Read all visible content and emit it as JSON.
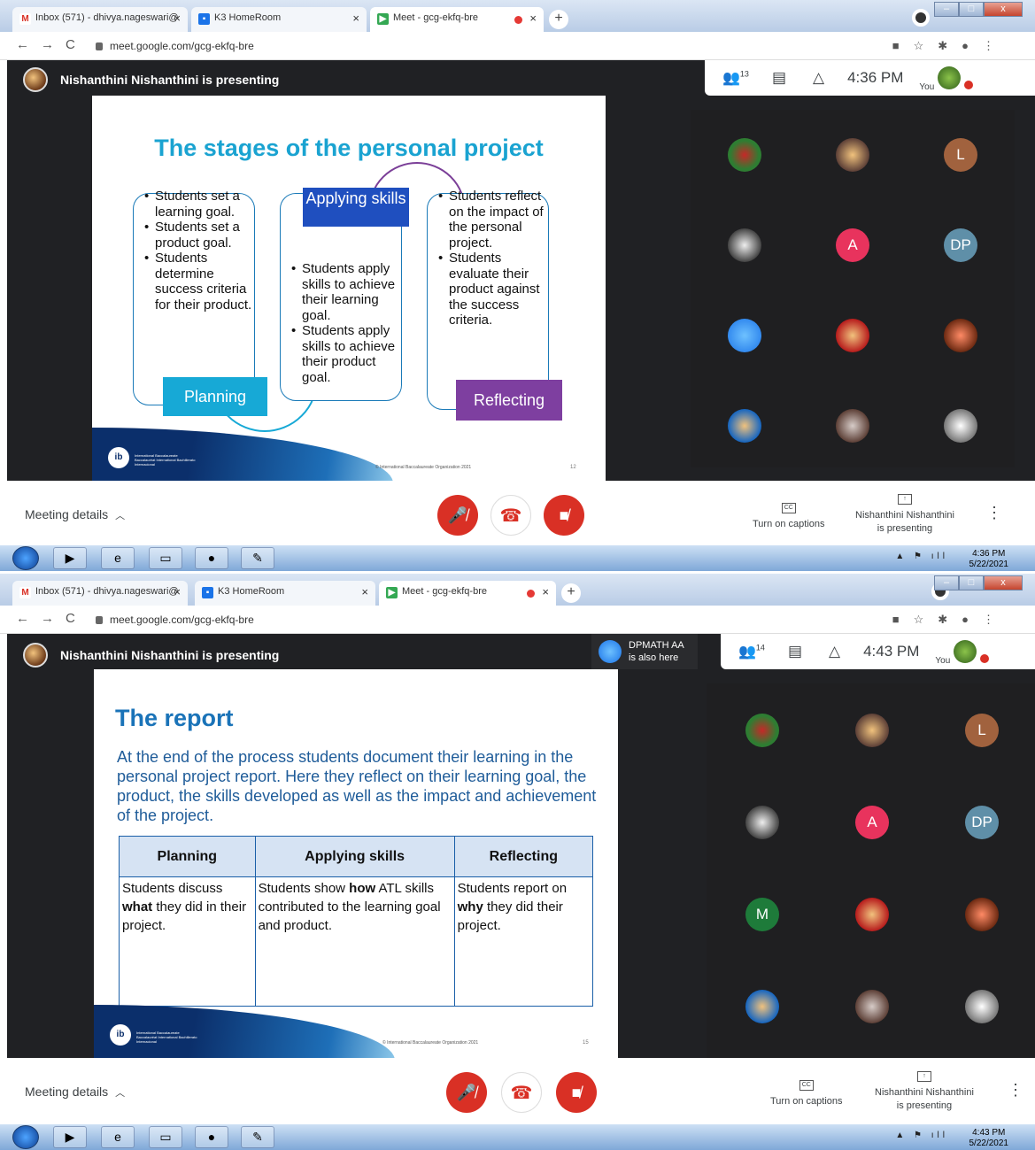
{
  "screens": [
    {
      "tabs": [
        {
          "label": "Inbox (571) - dhivya.nageswari@",
          "icon": "gmail-icon"
        },
        {
          "label": "K3 HomeRoom",
          "icon": "classroom-icon"
        },
        {
          "label": "Meet - gcg-ekfq-bre",
          "icon": "meet-icon"
        }
      ],
      "url": "meet.google.com/gcg-ekfq-bre",
      "presenting": "Nishanthini Nishanthini is presenting",
      "participant_count": "13",
      "time": "4:36 PM",
      "you_label": "You",
      "slide": {
        "title": "The stages of the personal project",
        "planning_bullets": [
          "Students set a learning goal.",
          "Students set a product goal.",
          "Students determine success criteria for their product."
        ],
        "applying_bullets": [
          "Students apply skills to achieve their learning goal.",
          "Students apply skills to achieve their product goal."
        ],
        "reflecting_bullets": [
          "Students reflect on the impact of the personal project.",
          "Students evaluate their product against the success criteria."
        ],
        "planning_label": "Planning",
        "applying_label": "Applying skills",
        "reflecting_label": "Reflecting",
        "copyright": "© International Baccalaureate Organization 2021",
        "page_number": "12",
        "ib_text": "International Baccalaureate Baccalauréat International Bachillerato Internacional"
      },
      "tiles": [
        "",
        "",
        "L",
        "",
        "A",
        "DP",
        "",
        "",
        "",
        "",
        "",
        ""
      ],
      "meeting_details": "Meeting details",
      "captions": "Turn on captions",
      "presenter_line1": "Nishanthini Nishanthini",
      "presenter_line2": "is presenting",
      "taskbar_time": "4:36 PM",
      "taskbar_date": "5/22/2021"
    },
    {
      "tabs": [
        {
          "label": "Inbox (571) - dhivya.nageswari@",
          "icon": "gmail-icon"
        },
        {
          "label": "K3 HomeRoom",
          "icon": "classroom-icon"
        },
        {
          "label": "Meet - gcg-ekfq-bre",
          "icon": "meet-icon"
        }
      ],
      "url": "meet.google.com/gcg-ekfq-bre",
      "presenting": "Nishanthini Nishanthini is presenting",
      "also_here_name": "DPMATH AA",
      "also_here_text": "is also here",
      "participant_count": "14",
      "time": "4:43 PM",
      "you_label": "You",
      "slide": {
        "title": "The report",
        "body": "At the end of the process students document their learning in the personal project report. Here they reflect on their learning goal, the product, the skills developed as well as the impact and achievement of the project.",
        "headers": [
          "Planning",
          "Applying skills",
          "Reflecting"
        ],
        "cells": [
          [
            "Students discuss ",
            "what",
            " they did in their project."
          ],
          [
            "Students show ",
            "how",
            " ATL skills contributed to the learning goal and product."
          ],
          [
            "Students report on ",
            "why",
            " they did their project."
          ]
        ],
        "copyright": "© International Baccalaureate Organization 2021",
        "page_number": "15",
        "ib_text": "International Baccalaureate Baccalauréat International Bachillerato Internacional"
      },
      "tiles": [
        "",
        "",
        "L",
        "",
        "A",
        "DP",
        "M",
        "",
        "",
        "",
        "",
        ""
      ],
      "meeting_details": "Meeting details",
      "captions": "Turn on captions",
      "presenter_line1": "Nishanthini Nishanthini",
      "presenter_line2": "is presenting",
      "taskbar_time": "4:43 PM",
      "taskbar_date": "5/22/2021"
    }
  ],
  "colors": {
    "meet_bg": "#202124",
    "end_call": "#d93025",
    "slide_title_1": "#1aa3d1",
    "planning_box": "#17a9d6",
    "applying_box": "#1f4fbf",
    "reflecting_box": "#7e3fa0",
    "tile_L": "#a1623e",
    "tile_A": "#e8335d",
    "tile_DP": "#5f8fa8",
    "tile_M": "#1e7b3a"
  }
}
